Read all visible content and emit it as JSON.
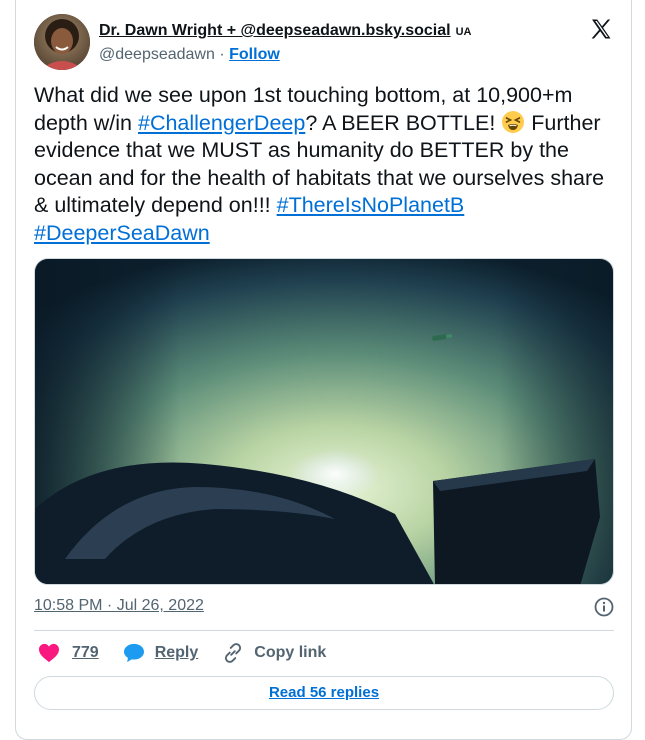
{
  "author": {
    "display_name": "Dr. Dawn Wright + @deepseadawn.bsky.social",
    "country_badge": "UA",
    "handle": "@deepseadawn",
    "separator": "·",
    "follow_label": "Follow",
    "avatar_icon": "profile-photo"
  },
  "tweet": {
    "text_1": "What did we see upon 1st touching bottom, at 10,900+m depth w/in ",
    "hashtag_1": "#ChallengerDeep",
    "text_2": "? A BEER BOTTLE! ",
    "text_3": " Further evidence that we MUST as humanity do BETTER by the ocean and for the health of habitats that we ourselves share & ultimately depend on!!! ",
    "hashtag_2": "#ThereIsNoPlanetB",
    "hashtag_3": "#DeeperSeaDawn",
    "emoji_icon": "tired-face-emoji"
  },
  "timestamp": "10:58 PM · Jul 26, 2022",
  "actions": {
    "like_count": "779",
    "reply_label": "Reply",
    "copy_label": "Copy link"
  },
  "read_replies_label": "Read 56 replies",
  "colors": {
    "link": "#006fd6",
    "like": "#f91880",
    "reply": "#1d9bf0",
    "muted": "#536471",
    "border": "#cfd9de"
  }
}
